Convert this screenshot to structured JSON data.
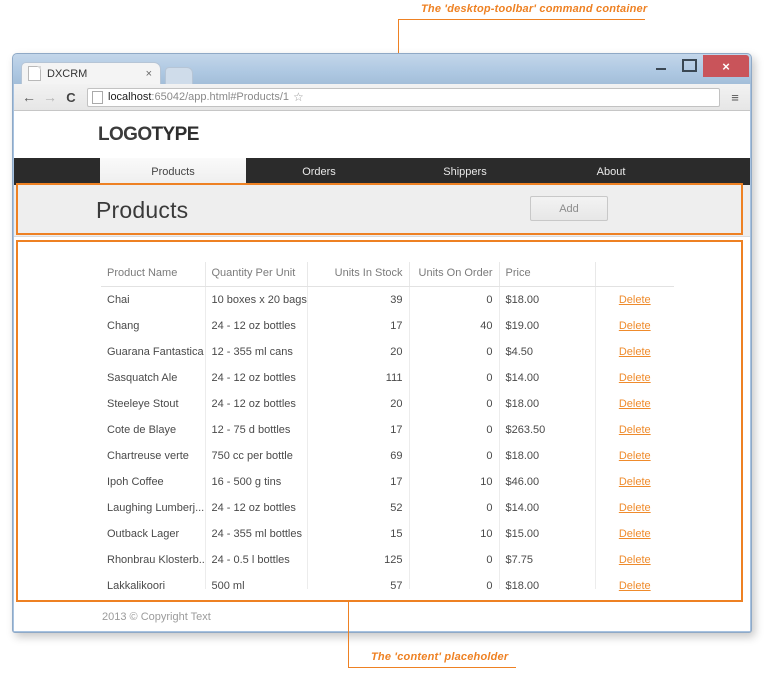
{
  "annotations": {
    "top": {
      "text": "The  'desktop-toolbar' command container"
    },
    "bottom": {
      "text": "The 'content' placeholder"
    },
    "accent_color": "#ee8123"
  },
  "browser": {
    "tab": {
      "title": "DXCRM",
      "close_label": "×"
    },
    "back_icon": "←",
    "forward_icon": "→",
    "reload_icon": "C",
    "url_prefix": "localhost",
    "url_rest": ":65042/app.html#Products/1",
    "star_icon": "☆",
    "menu_icon": "≡",
    "window_controls": {
      "minimize": "",
      "maximize": "",
      "close": "×"
    }
  },
  "site": {
    "logo": {
      "part1": "LOGO",
      "part2": "TYPE"
    },
    "nav": [
      {
        "label": "Products",
        "active": true
      },
      {
        "label": "Orders",
        "active": false
      },
      {
        "label": "Shippers",
        "active": false
      },
      {
        "label": "About",
        "active": false
      }
    ],
    "toolbar": {
      "title": "Products",
      "add_label": "Add"
    },
    "footer": {
      "copyright": "2013 © Copyright Text"
    }
  },
  "table": {
    "columns": [
      {
        "label": "Product Name",
        "align": "left"
      },
      {
        "label": "Quantity Per Unit",
        "align": "left"
      },
      {
        "label": "Units In Stock",
        "align": "right"
      },
      {
        "label": "Units On Order",
        "align": "right"
      },
      {
        "label": "Price",
        "align": "left"
      },
      {
        "label": "",
        "align": "center"
      }
    ],
    "action_label": "Delete",
    "rows": [
      {
        "name": "Chai",
        "qty": "10 boxes x 20 bags",
        "stock": "39",
        "order": "0",
        "price": "$18.00"
      },
      {
        "name": "Chang",
        "qty": "24 - 12 oz bottles",
        "stock": "17",
        "order": "40",
        "price": "$19.00"
      },
      {
        "name": "Guarana Fantastica",
        "qty": "12 - 355 ml cans",
        "stock": "20",
        "order": "0",
        "price": "$4.50"
      },
      {
        "name": "Sasquatch Ale",
        "qty": "24 - 12 oz bottles",
        "stock": "111",
        "order": "0",
        "price": "$14.00"
      },
      {
        "name": "Steeleye Stout",
        "qty": "24 - 12 oz bottles",
        "stock": "20",
        "order": "0",
        "price": "$18.00"
      },
      {
        "name": "Cote de Blaye",
        "qty": "12 - 75 d bottles",
        "stock": "17",
        "order": "0",
        "price": "$263.50"
      },
      {
        "name": "Chartreuse verte",
        "qty": "750 cc per bottle",
        "stock": "69",
        "order": "0",
        "price": "$18.00"
      },
      {
        "name": "Ipoh Coffee",
        "qty": "16 - 500 g tins",
        "stock": "17",
        "order": "10",
        "price": "$46.00"
      },
      {
        "name": "Laughing Lumberj...",
        "qty": "24 - 12 oz bottles",
        "stock": "52",
        "order": "0",
        "price": "$14.00"
      },
      {
        "name": "Outback Lager",
        "qty": "24 - 355 ml bottles",
        "stock": "15",
        "order": "10",
        "price": "$15.00"
      },
      {
        "name": "Rhonbrau Klosterb...",
        "qty": "24 - 0.5 l bottles",
        "stock": "125",
        "order": "0",
        "price": "$7.75"
      },
      {
        "name": "Lakkalikoori",
        "qty": "500 ml",
        "stock": "57",
        "order": "0",
        "price": "$18.00"
      }
    ]
  }
}
